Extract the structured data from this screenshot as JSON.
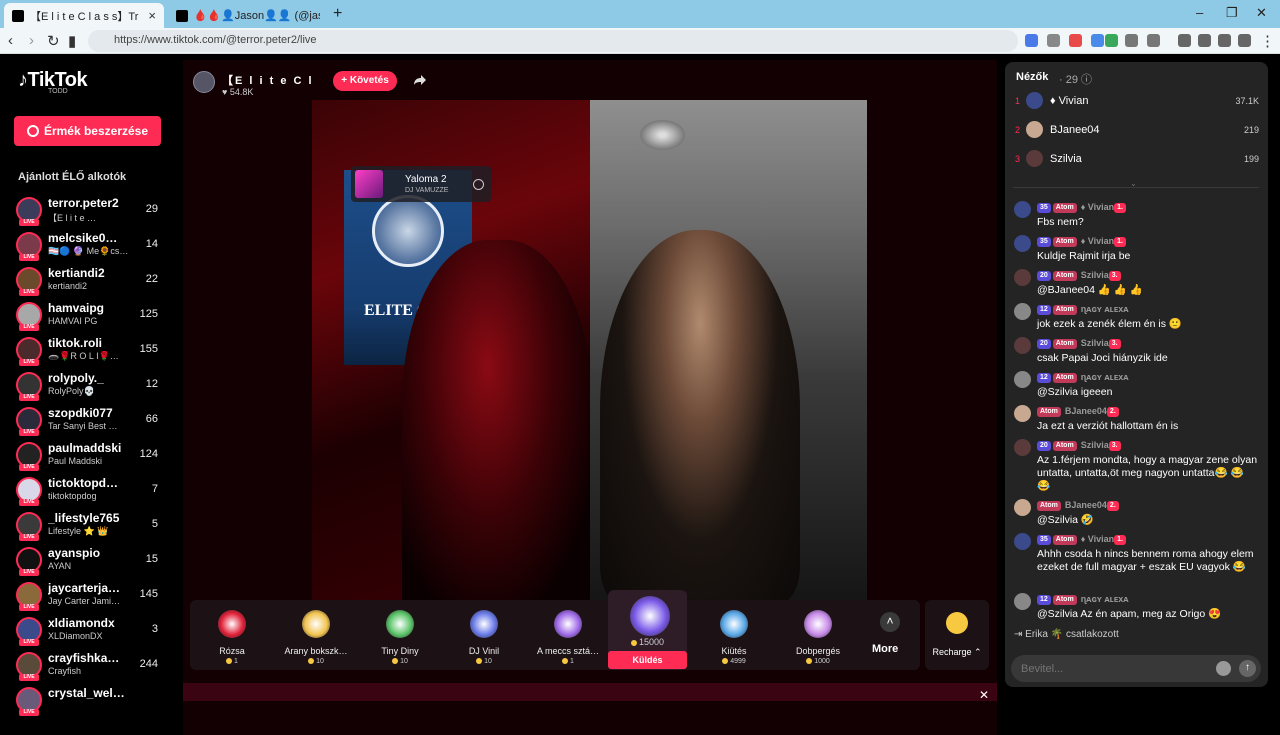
{
  "browser": {
    "tabs": [
      {
        "title": "【E l i t e   C l a s s】Tr"
      },
      {
        "title": "🩸🩸👤Jason👤👤 (@jason_sam"
      }
    ],
    "url": "https://www.tiktok.com/@terror.peter2/live"
  },
  "sidebar": {
    "logo": "TikTok",
    "logo_sub": "TODD",
    "coins_button": "Érmék beszerzése",
    "suggested_title": "Ajánlott ÉLŐ alkotók",
    "live_tag": "LIVE",
    "creators": [
      {
        "name": "terror.peter2",
        "sub": "【E l i t e  …",
        "count": "29",
        "color": "#3b3b5a"
      },
      {
        "name": "melcsike0…",
        "sub": "🏳‍⚧️🔵 🔮 Me🌻cs…",
        "count": "14",
        "color": "#7a3a4a"
      },
      {
        "name": "kertiandi2",
        "sub": "kertiandi2",
        "count": "22",
        "color": "#6a4a2a"
      },
      {
        "name": "hamvaipg",
        "sub": "HAMVAI PG",
        "count": "125",
        "color": "#a8a8a8"
      },
      {
        "name": "tiktok.roli",
        "sub": "🕳️🌹R O L I🌹…",
        "count": "155",
        "color": "#4a2a2a"
      },
      {
        "name": "rolypoly._",
        "sub": "RolyPoly💀",
        "count": "12",
        "color": "#333"
      },
      {
        "name": "szopdki077",
        "sub": "Tar Sanyi Best …",
        "count": "66",
        "color": "#2a2a3a"
      },
      {
        "name": "paulmaddski",
        "sub": "Paul Maddski",
        "count": "124",
        "color": "#222"
      },
      {
        "name": "tictoktopd…",
        "sub": "tiktoktopdog",
        "count": "7",
        "color": "#d8d8e8"
      },
      {
        "name": "_lifestyle765",
        "sub": "Lifestyle ⭐ 👑",
        "count": "5",
        "color": "#3a3a3a"
      },
      {
        "name": "ayanspio",
        "sub": "AYAN",
        "count": "15",
        "color": "#111"
      },
      {
        "name": "jaycarterja…",
        "sub": "Jay Carter Jami…",
        "count": "145",
        "color": "#8a6a3a"
      },
      {
        "name": "xldiamondx",
        "sub": "XLDiamonDX",
        "count": "3",
        "color": "#3a4a8a"
      },
      {
        "name": "crayfishka…",
        "sub": "Crayfish",
        "count": "244",
        "color": "#5a4a3a"
      },
      {
        "name": "crystal_wel…",
        "sub": "",
        "count": "",
        "color": "#6a5a7a"
      }
    ]
  },
  "stream": {
    "host_name": "【E l i t e   C l a s s】",
    "host_likes": "♥ 54.8K",
    "follow_label": "+ Követés",
    "music_title": "Yaloma 2",
    "music_artist": "DJ VAMUZZE",
    "poster_text": "ELITE C"
  },
  "gifts": {
    "items": [
      {
        "name": "Rózsa",
        "price": "1",
        "color": "#e0223a"
      },
      {
        "name": "Arany bokszk…",
        "price": "10",
        "color": "#f2c451"
      },
      {
        "name": "Tiny Diny",
        "price": "10",
        "color": "#5cc46a"
      },
      {
        "name": "DJ Vinil",
        "price": "10",
        "color": "#6a7ae8"
      },
      {
        "name": "A meccs sztá…",
        "price": "1",
        "color": "#a06ae8"
      },
      {
        "name": "",
        "price": "15000",
        "color": "#7a5ae8"
      },
      {
        "name": "Kiütés",
        "price": "4999",
        "color": "#5aa8e8"
      },
      {
        "name": "Dobpergés",
        "price": "1000",
        "color": "#c88ae8"
      }
    ],
    "send_label": "Küldés",
    "more_label": "More",
    "recharge_label": "Recharge ⌃"
  },
  "chat": {
    "viewers_label": "Nézők",
    "viewers_count": "· 29 ⓘ",
    "ranking": [
      {
        "rank": "1",
        "name": "♦ Vivian",
        "points": "37.1K",
        "color": "#3a4a8a"
      },
      {
        "rank": "2",
        "name": "BJanee04",
        "points": "219",
        "color": "#c8a890"
      },
      {
        "rank": "3",
        "name": "Szilvia",
        "points": "199",
        "color": "#5a3a3a"
      }
    ],
    "messages": [
      {
        "level": "35",
        "fan": "Atom",
        "user": "♦ Vivian",
        "sub": "1.",
        "text": "Fbs nem?",
        "color": "#3a4a8a"
      },
      {
        "level": "35",
        "fan": "Atom",
        "user": "♦ Vivian",
        "sub": "1.",
        "text": "Kuldje Rajmit irja be",
        "color": "#3a4a8a"
      },
      {
        "level": "20",
        "fan": "Atom",
        "user": "Szilvia",
        "sub": "3.",
        "text": "@BJanee04 👍 👍 👍",
        "color": "#5a3a3a"
      },
      {
        "level": "12",
        "fan": "Atom",
        "user": "ɳᴀɢʏ ᴀʟᴇxᴀ",
        "sub": "",
        "text": "jok ezek a zenék élem én is 🙂",
        "color": "#888"
      },
      {
        "level": "20",
        "fan": "Atom",
        "user": "Szilvia",
        "sub": "3.",
        "text": "csak Papai Joci hiányzik ide",
        "color": "#5a3a3a"
      },
      {
        "level": "12",
        "fan": "Atom",
        "user": "ɳᴀɢʏ ᴀʟᴇxᴀ",
        "sub": "",
        "text": "@Szilvia igeeen",
        "color": "#888"
      },
      {
        "level": "",
        "fan": "Atom",
        "user": "BJanee04",
        "sub": "2.",
        "text": "Ja ezt a verziót hallottam én is",
        "color": "#c8a890"
      },
      {
        "level": "20",
        "fan": "Atom",
        "user": "Szilvia",
        "sub": "3.",
        "text": "Az 1.férjem mondta, hogy a magyar zene olyan untatta, untatta,öt meg nagyon untatta😂 😂 😂",
        "color": "#5a3a3a"
      },
      {
        "level": "",
        "fan": "Atom",
        "user": "BJanee04",
        "sub": "2.",
        "text": "@Szilvia 🤣",
        "color": "#c8a890"
      },
      {
        "level": "35",
        "fan": "Atom",
        "user": "♦ Vivian",
        "sub": "1.",
        "text": "Ahhh csoda h nincs bennem roma ahogy elem ezeket de full magyar + eszak EU vagyok 😂",
        "color": "#3a4a8a"
      },
      {
        "level": "12",
        "fan": "Atom",
        "user": "ɳᴀɢʏ ᴀʟᴇxᴀ",
        "sub": "",
        "text": "@Szilvia Az én apam, meg az Origo 😍",
        "color": "#888"
      }
    ],
    "join_notice": "Erika 🌴  csatlakozott",
    "input_placeholder": "Bevitel..."
  }
}
